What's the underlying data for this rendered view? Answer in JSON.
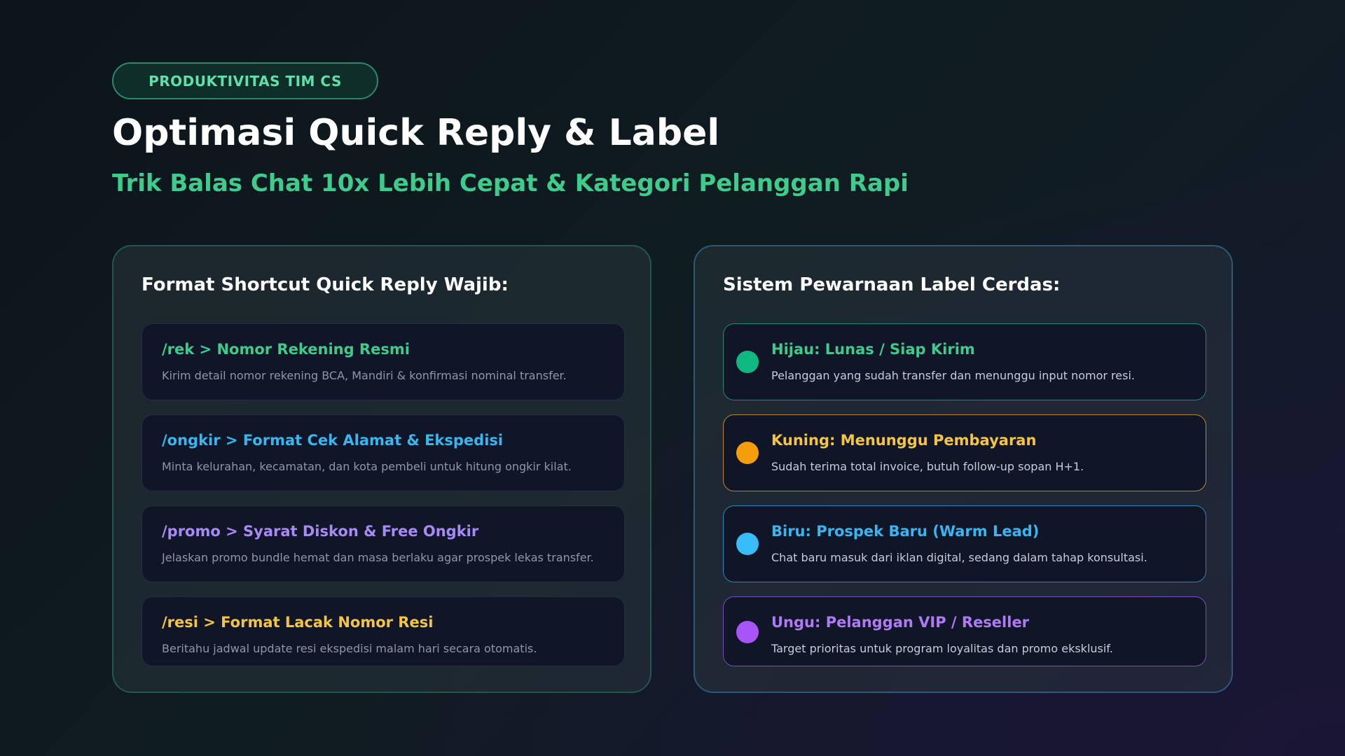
{
  "badge": "PRODUKTIVITAS TIM CS",
  "title": "Optimasi Quick Reply & Label",
  "subtitle": "Trik Balas Chat 10x Lebih Cepat & Kategori Pelanggan Rapi",
  "left_panel": {
    "title": "Format Shortcut Quick Reply Wajib:",
    "items": [
      {
        "heading": "/rek > Nomor Rekening Resmi",
        "desc": "Kirim detail nomor rekening BCA, Mandiri & konfirmasi nominal transfer.",
        "color": "#3ecb8c"
      },
      {
        "heading": "/ongkir > Format Cek Alamat & Ekspedisi",
        "desc": "Minta kelurahan, kecamatan, dan kota pembeli untuk hitung ongkir kilat.",
        "color": "#38b6f0"
      },
      {
        "heading": "/promo > Syarat Diskon & Free Ongkir",
        "desc": "Jelaskan promo bundle hemat dan masa berlaku agar prospek lekas transfer.",
        "color": "#a98af5"
      },
      {
        "heading": "/resi > Format Lacak Nomor Resi",
        "desc": "Beritahu jadwal update resi ekspedisi malam hari secara otomatis.",
        "color": "#f5c542"
      }
    ]
  },
  "right_panel": {
    "title": "Sistem Pewarnaan Label Cerdas:",
    "items": [
      {
        "heading": "Hijau: Lunas / Siap Kirim",
        "desc": "Pelanggan yang sudah transfer dan menunggu input nomor resi.",
        "color": "#3ecb8c",
        "dot": "#10b981",
        "border": "#1f8a72"
      },
      {
        "heading": "Kuning: Menunggu Pembayaran",
        "desc": "Sudah terima total invoice, butuh follow-up sopan H+1.",
        "color": "#f5c542",
        "dot": "#f59e0b",
        "border": "#b8862a"
      },
      {
        "heading": "Biru: Prospek Baru (Warm Lead)",
        "desc": "Chat baru masuk dari iklan digital, sedang dalam tahap konsultasi.",
        "color": "#38b6f0",
        "dot": "#38bdf8",
        "border": "#2a85b8"
      },
      {
        "heading": "Ungu: Pelanggan VIP / Reseller",
        "desc": "Target prioritas untuk program loyalitas dan promo eksklusif.",
        "color": "#b07af5",
        "dot": "#a855f7",
        "border": "#7a4ab8"
      }
    ]
  }
}
